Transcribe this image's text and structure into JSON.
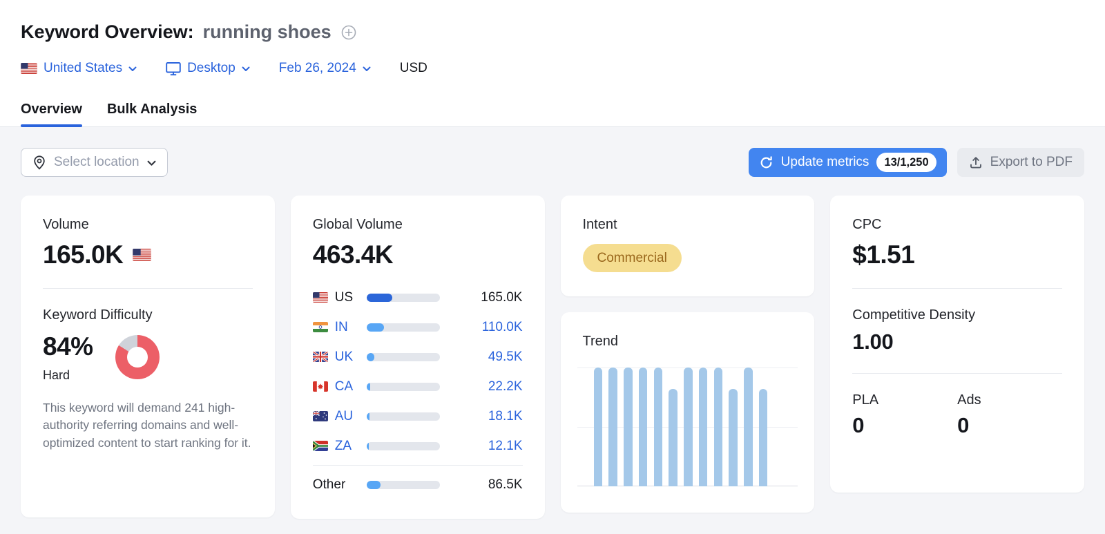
{
  "header": {
    "title": "Keyword Overview:",
    "keyword": "running shoes",
    "filters": {
      "country": "United States",
      "device": "Desktop",
      "date": "Feb 26, 2024",
      "currency": "USD"
    },
    "tabs": [
      {
        "label": "Overview",
        "active": true
      },
      {
        "label": "Bulk Analysis",
        "active": false
      }
    ]
  },
  "toolbar": {
    "select_location": "Select location",
    "update_metrics": "Update metrics",
    "update_count": "13/1,250",
    "export_pdf": "Export to PDF"
  },
  "cards": {
    "volume": {
      "label": "Volume",
      "value": "165.0K",
      "flag": "us-flag"
    },
    "keyword_difficulty": {
      "label": "Keyword Difficulty",
      "value": "84%",
      "percent": 84,
      "level": "Hard",
      "description": "This keyword will demand 241 high-authority referring domains and well-optimized content to start ranking for it."
    },
    "global_volume": {
      "label": "Global Volume",
      "value": "463.4K",
      "rows": [
        {
          "code": "US",
          "flag": "us-flag",
          "value": "165.0K",
          "pct": 35.6,
          "selected": true
        },
        {
          "code": "IN",
          "flag": "in-flag",
          "value": "110.0K",
          "pct": 23.7,
          "selected": false
        },
        {
          "code": "UK",
          "flag": "uk-flag",
          "value": "49.5K",
          "pct": 10.7,
          "selected": false
        },
        {
          "code": "CA",
          "flag": "ca-flag",
          "value": "22.2K",
          "pct": 4.8,
          "selected": false
        },
        {
          "code": "AU",
          "flag": "au-flag",
          "value": "18.1K",
          "pct": 3.9,
          "selected": false
        },
        {
          "code": "ZA",
          "flag": "za-flag",
          "value": "12.1K",
          "pct": 2.6,
          "selected": false
        }
      ],
      "other": {
        "label": "Other",
        "value": "86.5K",
        "pct": 18.7
      }
    },
    "intent": {
      "label": "Intent",
      "value": "Commercial"
    },
    "trend": {
      "label": "Trend"
    },
    "cpc": {
      "label": "CPC",
      "value": "$1.51"
    },
    "competitive_density": {
      "label": "Competitive Density",
      "value": "1.00"
    },
    "pla": {
      "label": "PLA",
      "value": "0"
    },
    "ads": {
      "label": "Ads",
      "value": "0"
    }
  },
  "chart_data": [
    {
      "type": "bar",
      "title": "Trend",
      "x": [
        "1",
        "2",
        "3",
        "4",
        "5",
        "6",
        "7",
        "8",
        "9",
        "10",
        "11",
        "12"
      ],
      "values_pct_of_max": [
        100,
        100,
        100,
        100,
        100,
        82,
        100,
        100,
        100,
        82,
        100,
        82
      ],
      "ylim": [
        0,
        100
      ],
      "grid": "three horizontal gridlines: top (max), middle (50%), baseline",
      "bar_color": "#a4c8e9",
      "tick_labels_shown": false
    },
    {
      "type": "bar",
      "title": "Global Volume by country",
      "categories": [
        "US",
        "IN",
        "UK",
        "CA",
        "AU",
        "ZA",
        "Other"
      ],
      "values": [
        165000,
        110000,
        49500,
        22200,
        18100,
        12100,
        86500
      ],
      "value_labels": [
        "165.0K",
        "110.0K",
        "49.5K",
        "22.2K",
        "18.1K",
        "12.1K",
        "86.5K"
      ],
      "total": 463400,
      "bar_fill_pct_of_track": [
        35.6,
        23.7,
        10.7,
        4.8,
        3.9,
        2.6,
        18.7
      ]
    },
    {
      "type": "pie",
      "title": "Keyword Difficulty donut",
      "labels": [
        "difficulty",
        "remainder"
      ],
      "values": [
        84,
        16
      ],
      "colors": [
        "#ec5f67",
        "#cfd3da"
      ]
    }
  ],
  "colors": {
    "link_blue": "#2a63dc",
    "button_blue": "#4285f0",
    "bar_selected": "#2b66d9",
    "bar_default": "#58a6f5",
    "bar_track": "#e3e6ec",
    "trend_bar": "#a4c8e9",
    "kd_red": "#ec5f67",
    "kd_track": "#cfd3da",
    "intent_bg": "#f5dd90",
    "intent_text": "#9a671c",
    "background": "#f4f5f8"
  },
  "icons": {
    "add-keyword-icon": "circle-plus ⊕",
    "chevron-down-icon": "chevron-down ⌄",
    "monitor-icon": "desktop monitor",
    "location-pin-icon": "map pin",
    "refresh-icon": "circular refresh arrow",
    "upload-icon": "export arrow up from tray",
    "flags": [
      "us-flag",
      "in-flag",
      "uk-flag",
      "ca-flag",
      "au-flag",
      "za-flag"
    ]
  }
}
